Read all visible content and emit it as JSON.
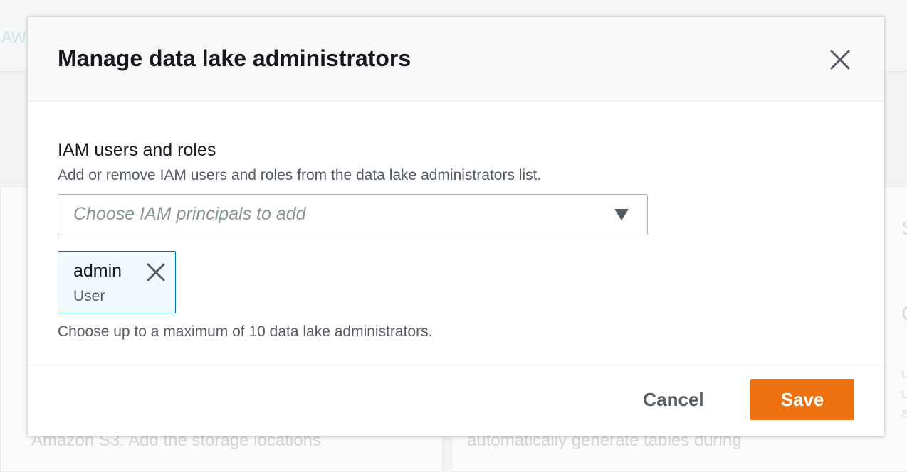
{
  "background": {
    "header_fragment": "AW",
    "left_panel_text": "Amazon S3. Add the storage locations",
    "right_panel_text": "automatically generate tables during",
    "right_edge_heading_fragment": "S",
    "right_edge_title_fragment": "C",
    "right_edge_lines": [
      "u",
      "u",
      "a"
    ]
  },
  "modal": {
    "title": "Manage data lake administrators",
    "close_icon": "close-icon",
    "field": {
      "label": "IAM users and roles",
      "description": "Add or remove IAM users and roles from the data lake administrators list.",
      "placeholder": "Choose IAM principals to add",
      "caret_icon": "caret-down-icon"
    },
    "tokens": [
      {
        "name": "admin",
        "type": "User",
        "remove_icon": "close-icon"
      }
    ],
    "constraint": "Choose up to a maximum of 10 data lake administrators.",
    "footer": {
      "cancel_label": "Cancel",
      "save_label": "Save"
    }
  },
  "colors": {
    "primary_button": "#ec7211",
    "token_border": "#0073bb",
    "token_background": "#f1faff",
    "title_text": "#16191f",
    "secondary_text": "#545b64",
    "placeholder_text": "#879596"
  }
}
